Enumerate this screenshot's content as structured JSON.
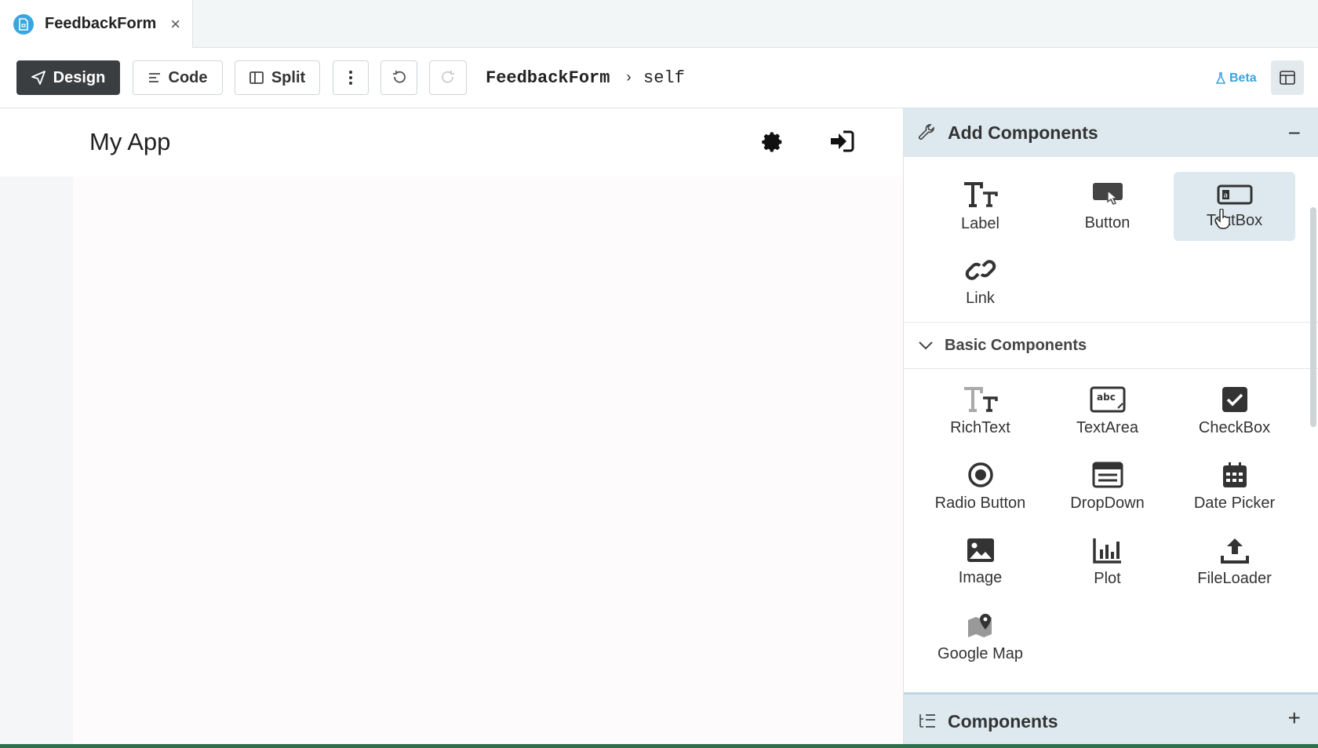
{
  "tab": {
    "title": "FeedbackForm",
    "close": "×"
  },
  "toolbar": {
    "design_label": "Design",
    "code_label": "Code",
    "split_label": "Split",
    "breadcrumb_form": "FeedbackForm",
    "breadcrumb_sep": "›",
    "breadcrumb_self": "self",
    "beta_label": "Beta"
  },
  "canvas": {
    "app_title": "My App"
  },
  "panel": {
    "add_title": "Add Components",
    "collapse": "−",
    "top_components": [
      "Label",
      "Button",
      "TextBox",
      "Link"
    ],
    "section_title": "Basic Components",
    "basic_components": [
      "RichText",
      "TextArea",
      "CheckBox",
      "Radio Button",
      "DropDown",
      "Date Picker",
      "Image",
      "Plot",
      "FileLoader",
      "Google Map"
    ],
    "components_title": "Components",
    "expand": "+"
  },
  "colors": {
    "accent": "#3aa6e0",
    "primary_button": "#3b3e40",
    "panel_header": "#dde9ef"
  }
}
